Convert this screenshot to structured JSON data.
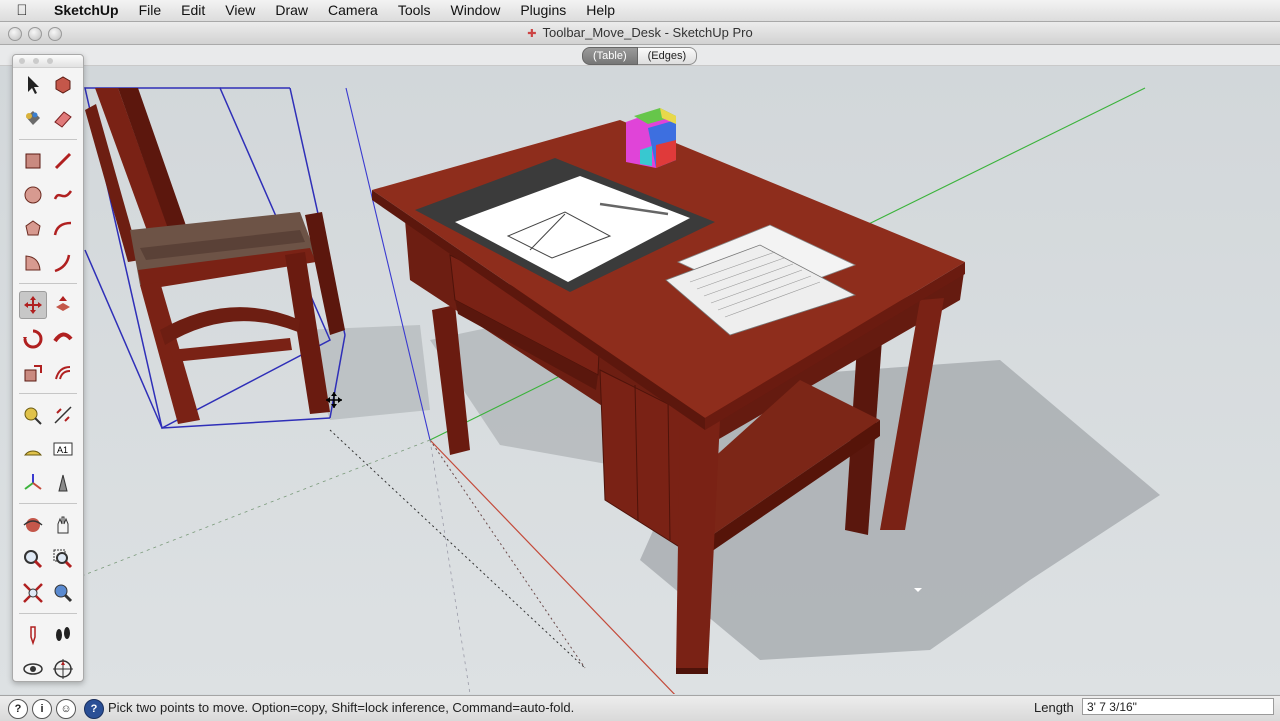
{
  "menubar": {
    "apple_icon": "apple-logo-icon",
    "items": [
      "SketchUp",
      "File",
      "Edit",
      "View",
      "Draw",
      "Camera",
      "Tools",
      "Window",
      "Plugins",
      "Help"
    ]
  },
  "window": {
    "title": "Toolbar_Move_Desk - SketchUp Pro",
    "doc_icon": "sketchup-doc-icon"
  },
  "scenes": {
    "tabs": [
      "(Table)",
      "(Edges)"
    ],
    "active_index": 0
  },
  "tools": [
    {
      "name": "select-icon"
    },
    {
      "name": "make-component-icon"
    },
    {
      "name": "paint-bucket-icon"
    },
    {
      "name": "eraser-icon"
    },
    {
      "name": "rectangle-icon"
    },
    {
      "name": "line-icon"
    },
    {
      "name": "circle-icon"
    },
    {
      "name": "freehand-icon"
    },
    {
      "name": "polygon-icon"
    },
    {
      "name": "arc-icon"
    },
    {
      "name": "pie-icon"
    },
    {
      "name": "three-point-arc-icon"
    },
    {
      "name": "move-icon"
    },
    {
      "name": "push-pull-icon"
    },
    {
      "name": "rotate-icon"
    },
    {
      "name": "follow-me-icon"
    },
    {
      "name": "scale-icon"
    },
    {
      "name": "offset-icon"
    },
    {
      "name": "tape-measure-icon"
    },
    {
      "name": "dimension-icon"
    },
    {
      "name": "protractor-icon"
    },
    {
      "name": "text-icon"
    },
    {
      "name": "axes-icon"
    },
    {
      "name": "3d-text-icon"
    },
    {
      "name": "orbit-icon"
    },
    {
      "name": "pan-icon"
    },
    {
      "name": "zoom-icon"
    },
    {
      "name": "zoom-window-icon"
    },
    {
      "name": "zoom-extents-icon"
    },
    {
      "name": "previous-view-icon"
    },
    {
      "name": "position-camera-icon"
    },
    {
      "name": "walk-icon"
    },
    {
      "name": "look-around-icon"
    },
    {
      "name": "section-plane-icon"
    }
  ],
  "selected_tool": "move-icon",
  "colors": {
    "desk_wood": "#7a2215",
    "desk_top": "#8e2d1c",
    "selection_blue": "#2f2fb8",
    "axis_red": "#c44a3a",
    "axis_green": "#3bb33b",
    "shadow": "#a9aeb1"
  },
  "statusbar": {
    "icons": [
      "geo-location-icon",
      "credits-icon",
      "user-icon",
      "help-icon"
    ],
    "message": "Pick two points to move.  Option=copy, Shift=lock inference, Command=auto-fold.",
    "length_label": "Length",
    "length_value": "3' 7 3/16\""
  }
}
